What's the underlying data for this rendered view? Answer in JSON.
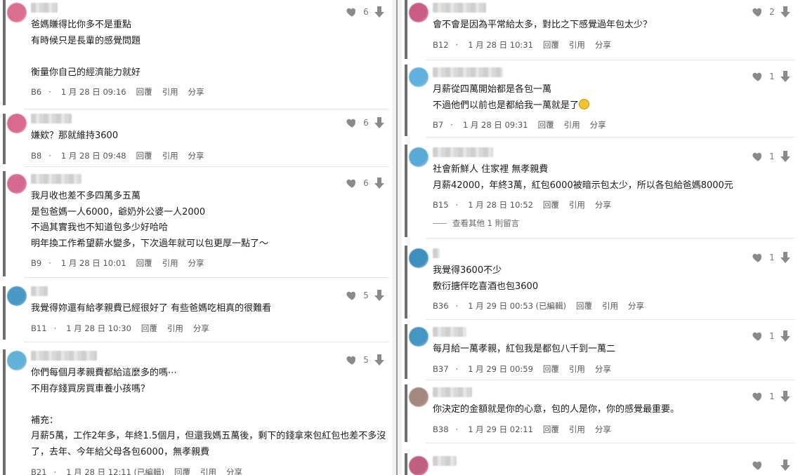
{
  "left": [
    {
      "avatar": "#d9708e",
      "name_w": 38,
      "likes": "6",
      "lines": [
        "爸媽賺得比你多不是重點",
        "有時候只是長輩的感覺問題",
        "",
        "衡量你自己的經濟能力就好"
      ],
      "floor": "B6",
      "date": "1 月 28 日 09:16"
    },
    {
      "avatar": "#d76a8d",
      "name_w": 58,
      "likes": "6",
      "lines": [
        "嫌欸？那就維持3600"
      ],
      "floor": "B8",
      "date": "1 月 28 日 09:48"
    },
    {
      "avatar": "#d46a8f",
      "name_w": 72,
      "likes": "6",
      "lines": [
        "我月收也差不多四萬多五萬",
        "是包爸媽一人6000，爺奶外公婆一人2000",
        "不過其實我也不知道包多少好哈哈",
        "明年換工作希望薪水變多，下次過年就可以包更厚一點了～"
      ],
      "floor": "B9",
      "date": "1 月 28 日 10:01"
    },
    {
      "avatar": "#4a98c6",
      "name_w": 24,
      "likes": "5",
      "lines": [
        "我覺得妳還有給孝親費已經很好了 有些爸媽吃相真的很難看"
      ],
      "floor": "B11",
      "date": "1 月 28 日 10:30"
    },
    {
      "avatar": "#62b2d8",
      "name_w": 94,
      "likes": "5",
      "lines": [
        "你們每個月孝親費都給這麼多的嗎⋯",
        "不用存錢買房買車養小孩嗎？",
        "",
        "補充：",
        "月薪5萬，工作2年多，年終1.5個月，但還我媽五萬後，剩下的錢拿來包紅包也差不多沒",
        "了，去年、今年給父母各包6000，無孝親費"
      ],
      "floor": "B21",
      "date": "1 月 28 日 12:11 (已編輯)"
    }
  ],
  "right": [
    {
      "avatar": "#c95c85",
      "name_w": 76,
      "likes": "2",
      "lines": [
        "會不會是因為平常給太多，對比之下感覺過年包太少？"
      ],
      "floor": "B12",
      "date": "1 月 28 日 10:31"
    },
    {
      "avatar": "#5fb2dc",
      "name_w": 100,
      "likes": "1",
      "lines": [
        "月薪從四萬開始都是各包一萬",
        "不過他們以前也是都給我一萬就是了"
      ],
      "emoji_line": 1,
      "floor": "B7",
      "date": "1 月 28 日 09:31"
    },
    {
      "avatar": "#5aaad6",
      "name_w": 86,
      "likes": "1",
      "lines": [
        "社會新鮮人 住家裡 無孝親費",
        "月薪42000，年終3萬，紅包6000被暗示包太少，所以各包給爸媽8000元"
      ],
      "floor": "B15",
      "date": "1 月 28 日 10:52",
      "more": "查看其他 1 則留言"
    },
    {
      "avatar": "#3f8fbe",
      "name_w": 10,
      "likes": "1",
      "lines": [
        "我覺得3600不少",
        "敷衍搪伴吃喜酒也包3600"
      ],
      "floor": "B36",
      "date": "1 月 29 日 00:53 (已編輯)"
    },
    {
      "avatar": "#4596c3",
      "name_w": 48,
      "likes": "1",
      "lines": [
        "每月給一萬孝親，紅包我是都包八千到一萬二"
      ],
      "floor": "B37",
      "date": "1 月 29 日 00:59"
    },
    {
      "avatar": "#a6877d",
      "name_w": 56,
      "likes": "1",
      "lines": [
        "你決定的金額就是你的心意，包的人是你，你的感覺最重要。"
      ],
      "floor": "B38",
      "date": "1 月 29 日 02:11"
    },
    {
      "avatar": "#c06080",
      "name_w": 34,
      "likes": "",
      "lines": [],
      "floor": "",
      "date": ""
    }
  ],
  "actions": {
    "reply": "回覆",
    "quote": "引用",
    "share": "分享"
  },
  "icons": {
    "like": "heart-icon",
    "dislike": "down-arrow-icon"
  },
  "colors": {
    "icon": "#8a8a8a",
    "rule": "#6f6f6f",
    "text": "#1a1a1a",
    "meta": "#555555"
  }
}
